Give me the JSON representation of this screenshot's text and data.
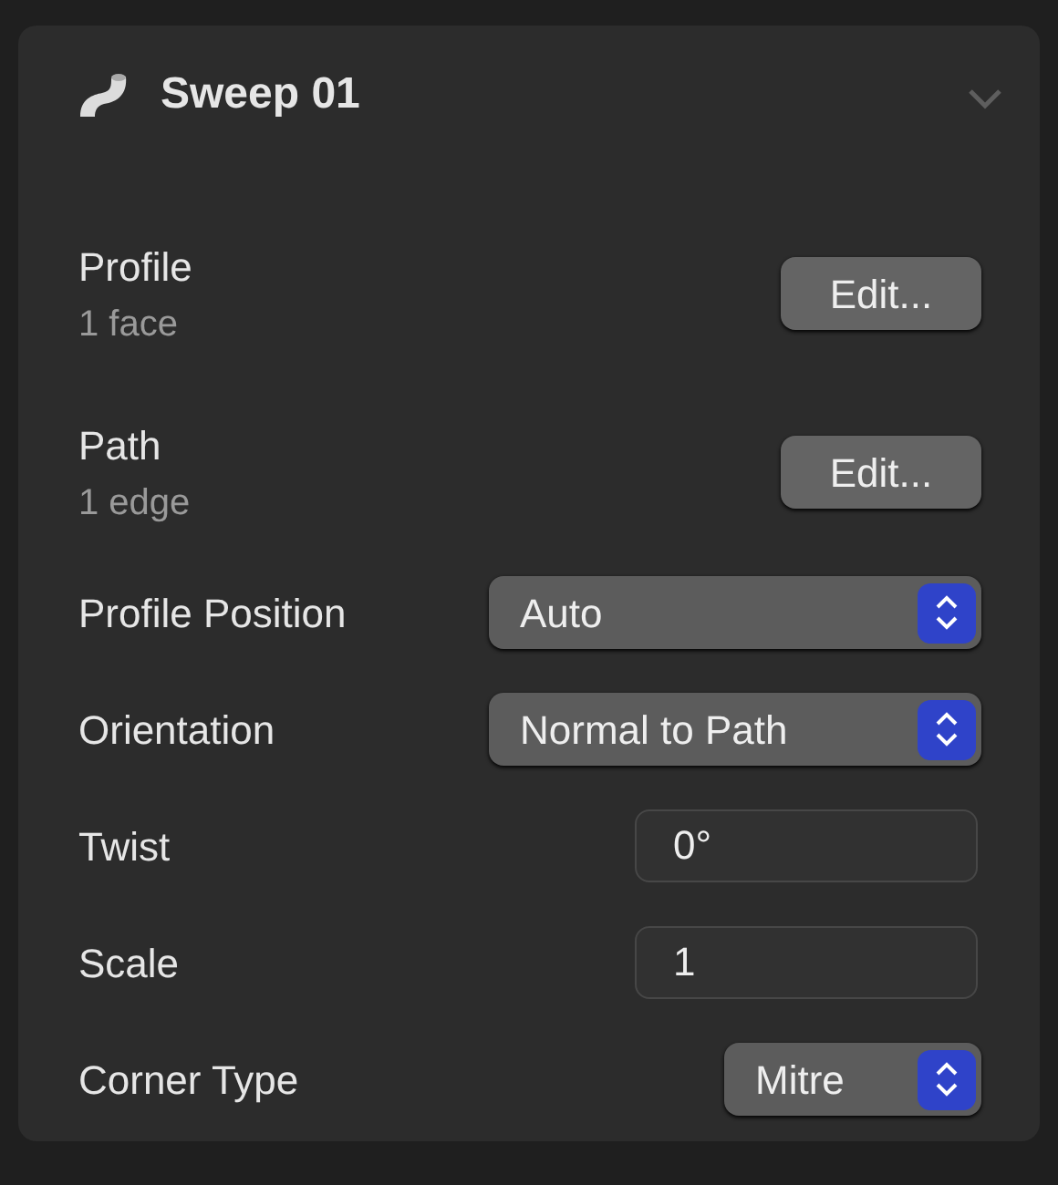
{
  "panel": {
    "title": "Sweep 01",
    "expanded": true
  },
  "rows": [
    {
      "kind": "edit",
      "label": "Profile",
      "detail": "1 face",
      "button": "Edit..."
    },
    {
      "kind": "edit",
      "label": "Path",
      "detail": "1 edge",
      "button": "Edit..."
    },
    {
      "kind": "popup",
      "label": "Profile Position",
      "value": "Auto"
    },
    {
      "kind": "popup",
      "label": "Orientation",
      "value": "Normal to Path"
    },
    {
      "kind": "field",
      "label": "Twist",
      "value": "0°"
    },
    {
      "kind": "field",
      "label": "Scale",
      "value": "1"
    },
    {
      "kind": "small-popup",
      "label": "Corner Type",
      "value": "Mitre"
    }
  ]
}
